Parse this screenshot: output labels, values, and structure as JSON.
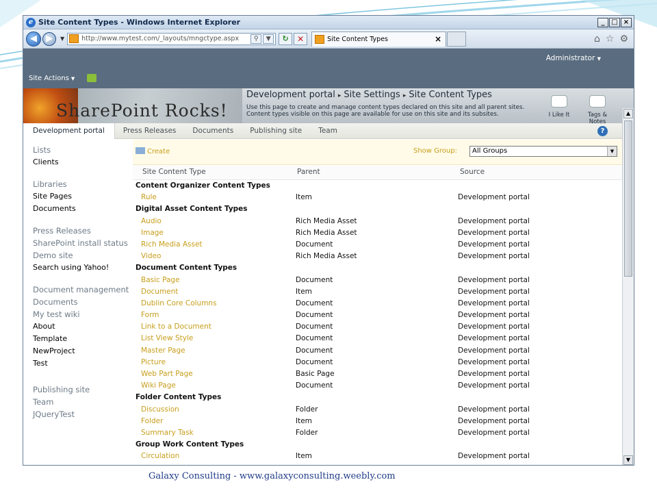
{
  "window": {
    "title": "Site Content Types - Windows Internet Explorer",
    "min": "_",
    "max": "□",
    "close": "×"
  },
  "browser": {
    "url": "http://www.mytest.com/_layouts/mngctype.aspx",
    "tab_title": "Site Content Types",
    "tab_close": "×"
  },
  "ribbon": {
    "site_actions": "Site Actions",
    "user": "Administrator"
  },
  "banner": {
    "logo_text": "SharePoint Rocks!",
    "breadcrumb": [
      "Development portal",
      "Site Settings",
      "Site Content Types"
    ],
    "description": "Use this page to create and manage content types declared on this site and all parent sites. Content types visible on this page are available for use on this site and its subsites.",
    "i_like_it": "I Like It",
    "tags_notes": "Tags & Notes"
  },
  "topnav": [
    "Development portal",
    "Press Releases",
    "Documents",
    "Publishing site",
    "Team"
  ],
  "leftnav": [
    {
      "label": "Lists",
      "style": "hdr"
    },
    {
      "label": "Clients",
      "style": "item"
    },
    {
      "label": "Libraries",
      "style": "hdr gap"
    },
    {
      "label": "Site Pages",
      "style": "item"
    },
    {
      "label": "Documents",
      "style": "item"
    },
    {
      "label": "Press Releases",
      "style": "hdr gap"
    },
    {
      "label": "SharePoint install status",
      "style": "hdr"
    },
    {
      "label": "Demo site",
      "style": "hdr"
    },
    {
      "label": "Search using Yahoo!",
      "style": "item"
    },
    {
      "label": "Document management",
      "style": "hdr gap"
    },
    {
      "label": "Documents",
      "style": "hdr"
    },
    {
      "label": "My test wiki",
      "style": "hdr"
    },
    {
      "label": "About",
      "style": "item"
    },
    {
      "label": "Template",
      "style": "item"
    },
    {
      "label": "NewProject",
      "style": "item"
    },
    {
      "label": "Test",
      "style": "item"
    },
    {
      "label": "Publishing site",
      "style": "hdr gap2"
    },
    {
      "label": "Team",
      "style": "hdr"
    },
    {
      "label": "JQueryTest",
      "style": "hdr"
    }
  ],
  "toolbar": {
    "create": "Create",
    "show_group_label": "Show Group:",
    "show_group_value": "All Groups"
  },
  "table": {
    "headers": [
      "Site Content Type",
      "Parent",
      "Source"
    ],
    "rows": [
      {
        "group": "Content Organizer Content Types"
      },
      {
        "name": "Rule",
        "parent": "Item",
        "source": "Development portal"
      },
      {
        "group": "Digital Asset Content Types"
      },
      {
        "name": "Audio",
        "parent": "Rich Media Asset",
        "source": "Development portal"
      },
      {
        "name": "Image",
        "parent": "Rich Media Asset",
        "source": "Development portal"
      },
      {
        "name": "Rich Media Asset",
        "parent": "Document",
        "source": "Development portal"
      },
      {
        "name": "Video",
        "parent": "Rich Media Asset",
        "source": "Development portal"
      },
      {
        "group": "Document Content Types"
      },
      {
        "name": "Basic Page",
        "parent": "Document",
        "source": "Development portal"
      },
      {
        "name": "Document",
        "parent": "Item",
        "source": "Development portal"
      },
      {
        "name": "Dublin Core Columns",
        "parent": "Document",
        "source": "Development portal"
      },
      {
        "name": "Form",
        "parent": "Document",
        "source": "Development portal"
      },
      {
        "name": "Link to a Document",
        "parent": "Document",
        "source": "Development portal"
      },
      {
        "name": "List View Style",
        "parent": "Document",
        "source": "Development portal"
      },
      {
        "name": "Master Page",
        "parent": "Document",
        "source": "Development portal"
      },
      {
        "name": "Picture",
        "parent": "Document",
        "source": "Development portal"
      },
      {
        "name": "Web Part Page",
        "parent": "Basic Page",
        "source": "Development portal"
      },
      {
        "name": "Wiki Page",
        "parent": "Document",
        "source": "Development portal"
      },
      {
        "group": "Folder Content Types"
      },
      {
        "name": "Discussion",
        "parent": "Folder",
        "source": "Development portal"
      },
      {
        "name": "Folder",
        "parent": "Item",
        "source": "Development portal"
      },
      {
        "name": "Summary Task",
        "parent": "Folder",
        "source": "Development portal"
      },
      {
        "group": "Group Work Content Types"
      },
      {
        "name": "Circulation",
        "parent": "Item",
        "source": "Development portal"
      }
    ]
  },
  "caption": "Galaxy Consulting - www.galaxyconsulting.weebly.com",
  "colors": {
    "link_gold": "#c79e1a",
    "ribbon": "#5a6c7f",
    "caption_blue": "#1f3b88"
  }
}
